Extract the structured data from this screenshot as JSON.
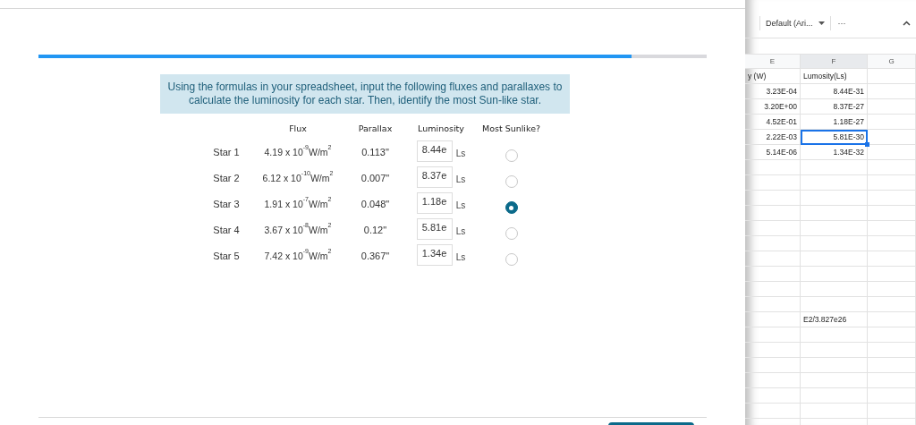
{
  "progress": {
    "level": 0.888
  },
  "prompt": "Using the formulas in your spreadsheet, input the following fluxes and parallaxes to calculate the luminosity for each star. Then, identify the most Sun-like star.",
  "table": {
    "columns": [
      "Flux",
      "Parallax",
      "Luminosity",
      "Most Sunlike?"
    ],
    "rows": [
      {
        "label": "Star 1",
        "flux": "4.19 x 10$^{-9}$W/m$^{2}$",
        "parallax": "0.113\"",
        "luminosity": "8.44e",
        "unit": "Ls",
        "selected": false
      },
      {
        "label": "Star 2",
        "flux": "6.12 x 10$^{-10}$W/m$^{2}$",
        "parallax": "0.007\"",
        "luminosity": "8.37e",
        "unit": "Ls",
        "selected": false
      },
      {
        "label": "Star 3",
        "flux": "1.91 x 10$^{-7}$W/m$^{2}$",
        "parallax": "0.048\"",
        "luminosity": "1.18e",
        "unit": "Ls",
        "selected": true
      },
      {
        "label": "Star 4",
        "flux": "3.67 x 10$^{-8}$W/m$^{2}$",
        "parallax": "0.12\"",
        "luminosity": "5.81e",
        "unit": "Ls",
        "selected": false
      },
      {
        "label": "Star 5",
        "flux": "7.42 x 10$^{-9}$W/m$^{2}$",
        "parallax": "0.367\"",
        "luminosity": "1.34e",
        "unit": "Ls",
        "selected": false
      }
    ]
  },
  "spreadsheet": {
    "font_dropdown": "Default (Ari...",
    "more_button": "···",
    "columns": [
      "E",
      "F",
      "G"
    ],
    "rows": [
      {
        "e": "y (W)",
        "f": "Lumosity(Ls)",
        "kind": "label",
        "selected": false
      },
      {
        "e": "3.23E-04",
        "f": "8.44E-31",
        "kind": "number",
        "selected": false
      },
      {
        "e": "3.20E+00",
        "f": "8.37E-27",
        "kind": "number",
        "selected": false
      },
      {
        "e": "4.52E-01",
        "f": "1.18E-27",
        "kind": "number",
        "selected": false
      },
      {
        "e": "2.22E-03",
        "f": "5.81E-30",
        "kind": "number",
        "selected": true
      },
      {
        "e": "5.14E-06",
        "f": "1.34E-32",
        "kind": "number",
        "selected": false
      }
    ],
    "lower_cell": "E2/3.827e26"
  }
}
